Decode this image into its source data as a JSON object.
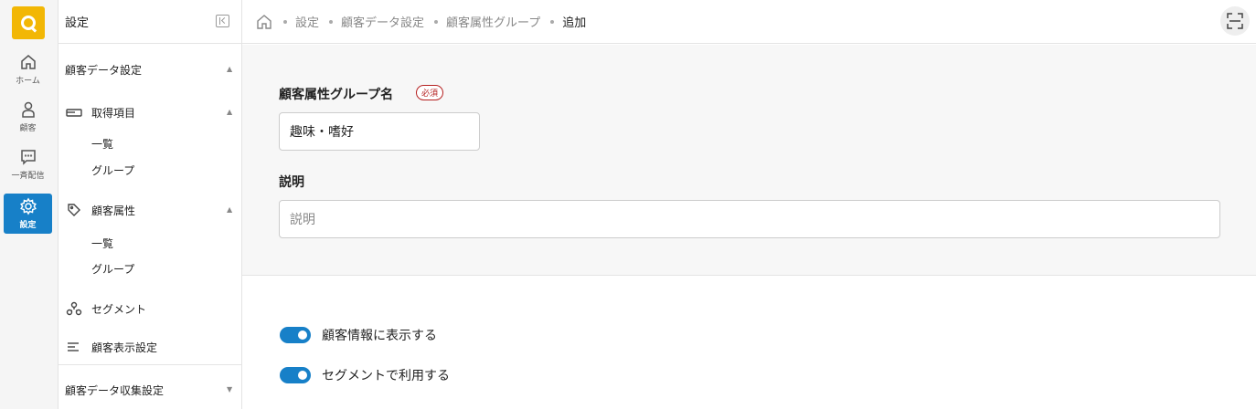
{
  "rail": {
    "items": [
      {
        "label": "ホーム",
        "icon": "home-icon"
      },
      {
        "label": "顧客",
        "icon": "person-icon"
      },
      {
        "label": "一斉配信",
        "icon": "chat-icon"
      },
      {
        "label": "設定",
        "icon": "gear-icon",
        "active": true
      }
    ]
  },
  "sidebar": {
    "title": "設定",
    "sections": [
      {
        "label": "顧客データ設定"
      },
      {
        "label": "顧客データ収集設定"
      }
    ],
    "groups": [
      {
        "label": "取得項目",
        "icon": "card-icon",
        "children": [
          "一覧",
          "グループ"
        ]
      },
      {
        "label": "顧客属性",
        "icon": "tag-icon",
        "children": [
          "一覧",
          "グループ"
        ]
      },
      {
        "label": "セグメント",
        "icon": "segment-icon"
      },
      {
        "label": "顧客表示設定",
        "icon": "list-icon"
      }
    ]
  },
  "breadcrumb": [
    "設定",
    "顧客データ設定",
    "顧客属性グループ",
    "追加"
  ],
  "form": {
    "name_label": "顧客属性グループ名",
    "required_badge": "必須",
    "name_value": "趣味・嗜好",
    "desc_label": "説明",
    "desc_placeholder": "説明"
  },
  "toggles": [
    {
      "label": "顧客情報に表示する",
      "on": true
    },
    {
      "label": "セグメントで利用する",
      "on": true
    }
  ],
  "colors": {
    "accent": "#1780c8",
    "logo": "#f2b705",
    "required": "#b52020"
  }
}
